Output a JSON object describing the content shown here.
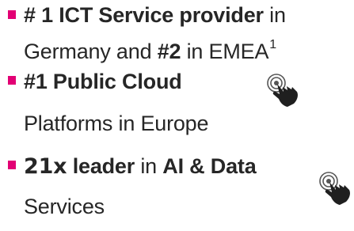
{
  "items": [
    {
      "line1": {
        "bold_a": "# 1 ICT Service provider",
        "text_a": " in"
      },
      "line2": {
        "text_a": "Germany and ",
        "bold_b": "#2",
        "text_b": " in EMEA",
        "footnote": "1"
      }
    },
    {
      "line1": {
        "bold_a": "#1 Public Cloud"
      },
      "line2": {
        "text_a": "Platforms in Europe"
      },
      "icon": "hand-tap-icon"
    },
    {
      "line1": {
        "bold_a": "21x",
        "bold_b": "leader",
        "text_a": " in ",
        "bold_c": "AI & Data"
      },
      "line2": {
        "text_a": "Services"
      },
      "icon": "hand-tap-icon"
    }
  ],
  "colors": {
    "bullet": "#e20074",
    "text": "#262626"
  }
}
